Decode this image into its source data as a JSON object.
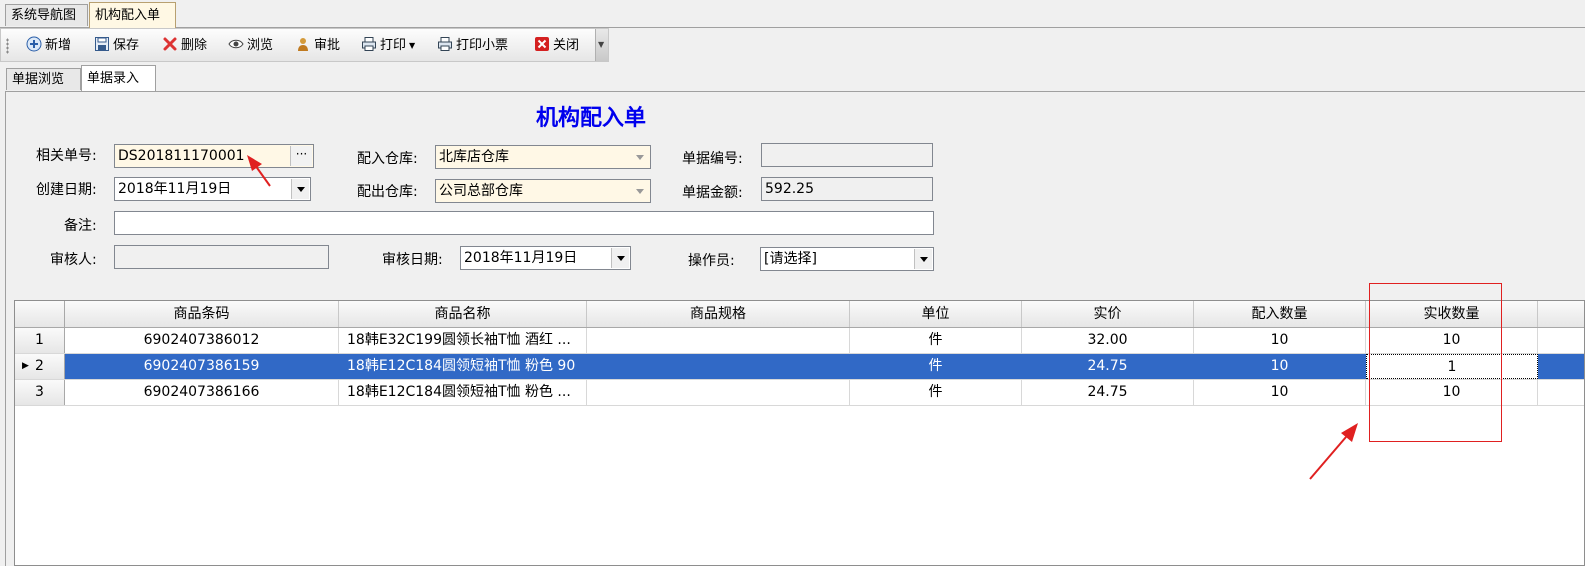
{
  "doc_tabs": [
    {
      "label": "系统导航图",
      "active": false
    },
    {
      "label": "机构配入单",
      "active": true
    }
  ],
  "toolbar": {
    "buttons": [
      {
        "label": "新增",
        "icon": "add-icon"
      },
      {
        "label": "保存",
        "icon": "save-icon"
      },
      {
        "label": "删除",
        "icon": "delete-icon"
      },
      {
        "label": "浏览",
        "icon": "view-icon"
      },
      {
        "label": "审批",
        "icon": "approve-icon"
      },
      {
        "label": "打印",
        "icon": "print-icon"
      },
      {
        "label": "打印小票",
        "icon": "print-icon"
      },
      {
        "label": "关闭",
        "icon": "close-icon"
      }
    ]
  },
  "inner_tabs": [
    {
      "label": "单据浏览",
      "active": false
    },
    {
      "label": "单据录入",
      "active": true
    }
  ],
  "form": {
    "title": "机构配入单",
    "related_no": {
      "label": "相关单号:",
      "value": "DS201811170001"
    },
    "in_warehouse": {
      "label": "配入仓库:",
      "value": "北库店仓库"
    },
    "doc_no": {
      "label": "单据编号:",
      "value": ""
    },
    "create_date": {
      "label": "创建日期:",
      "value": "2018年11月19日"
    },
    "out_warehouse": {
      "label": "配出仓库:",
      "value": "公司总部仓库"
    },
    "doc_amount": {
      "label": "单据金额:",
      "value": "592.25"
    },
    "remark": {
      "label": "备注:",
      "value": ""
    },
    "reviewer": {
      "label": "审核人:",
      "value": ""
    },
    "review_date": {
      "label": "审核日期:",
      "value": "2018年11月19日"
    },
    "operator": {
      "label": "操作员:",
      "value": "[请选择]"
    }
  },
  "grid": {
    "columns": [
      "商品条码",
      "商品名称",
      "商品规格",
      "单位",
      "实价",
      "配入数量",
      "实收数量"
    ],
    "rows": [
      {
        "no": "1",
        "barcode": "6902407386012",
        "name": "18韩E32C199圆领长袖T恤 酒红 ...",
        "spec": "",
        "unit": "件",
        "price": "32.00",
        "in_qty": "10",
        "recv_qty": "10",
        "selected": false
      },
      {
        "no": "2",
        "barcode": "6902407386159",
        "name": "18韩E12C184圆领短袖T恤 粉色 90",
        "spec": "",
        "unit": "件",
        "price": "24.75",
        "in_qty": "10",
        "recv_qty": "1",
        "selected": true
      },
      {
        "no": "3",
        "barcode": "6902407386166",
        "name": "18韩E12C184圆领短袖T恤 粉色 ...",
        "spec": "",
        "unit": "件",
        "price": "24.75",
        "in_qty": "10",
        "recv_qty": "10",
        "selected": false
      }
    ]
  },
  "colors": {
    "title": "#0000ee",
    "selection": "#3169c6",
    "annotation": "#e02020"
  }
}
